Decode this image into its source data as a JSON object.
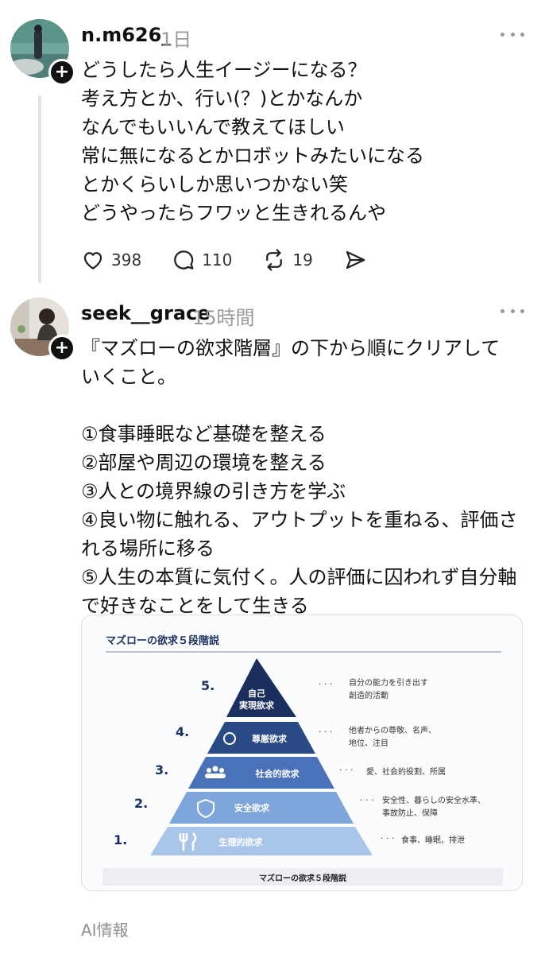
{
  "post1": {
    "username": "n.m626_",
    "time": "1日",
    "text": "どうしたら人生イージーになる？\n考え方とか、行い(？)とかなんか\nなんでもいいんで教えてほしい\n常に無になるとかロボットみたいになる\nとかくらいしか思いつかない笑\nどうやったらフワッと生きれるんや",
    "likes": "398",
    "replies": "110",
    "reposts": "19"
  },
  "post2": {
    "username": "seek__grace",
    "time": "15時間",
    "text": "『マズローの欲求階層』の下から順にクリアしていくこと。\n\n①食事睡眠など基礎を整える\n②部屋や周辺の環境を整える\n③人との境界線の引き方を学ぶ\n④良い物に触れる、アウトプットを重ねる、評価される場所に移る\n⑤人生の本質に気付く。人の評価に囚われず自分軸で好きなことをして生きる"
  },
  "pyramid": {
    "heading": "マズローの欲求５段階説",
    "caption": "マズローの欲求５段階説",
    "levels": [
      {
        "num": "5.",
        "label1": "自己",
        "label2": "実現欲求",
        "desc1": "自分の能力を引き出す",
        "desc2": "創造的活動",
        "color": "#1b2f5e"
      },
      {
        "num": "4.",
        "label1": "尊厳欲求",
        "desc1": "他者からの尊敬、名声、",
        "desc2": "地位、注目",
        "color": "#2a4a86"
      },
      {
        "num": "3.",
        "label1": "社会的欲求",
        "desc1": "愛、社会的役割、所属",
        "color": "#4a72b8"
      },
      {
        "num": "2.",
        "label1": "安全欲求",
        "desc1": "安全性、暮らしの安全水準、",
        "desc2": "事故防止、保障",
        "color": "#7ea6da"
      },
      {
        "num": "1.",
        "label1": "生理的欲求",
        "desc1": "食事、睡眠、排泄",
        "color": "#a9c6ea"
      }
    ]
  },
  "footer": {
    "ai_info": "AI情報"
  }
}
